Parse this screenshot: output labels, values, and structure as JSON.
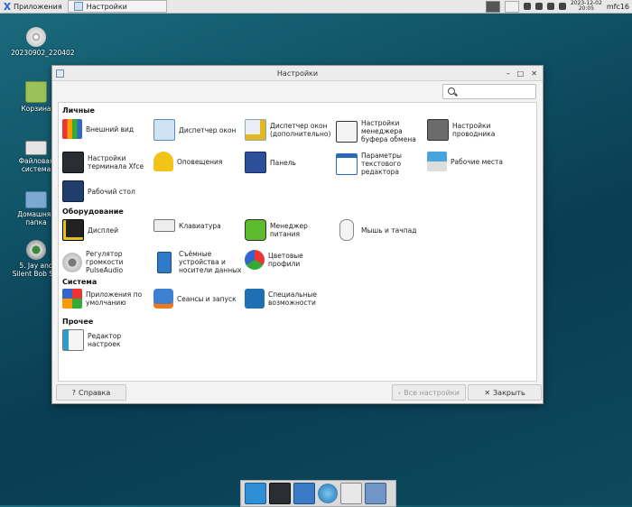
{
  "topbar": {
    "apps_label": "Приложения",
    "task_label": "Настройки",
    "clock_date": "2023-12-02",
    "clock_time": "20:05",
    "user": "mfc16"
  },
  "desktop": [
    {
      "label": "20230902_220402",
      "icon": "disc-icon"
    },
    {
      "label": "Корзина",
      "icon": "trash-icon"
    },
    {
      "label": "Файловая система",
      "icon": "drive-icon"
    },
    {
      "label": "Домашняя папка",
      "icon": "home-folder-icon"
    },
    {
      "label": "5. Jay and Silent Bob S...",
      "icon": "film-icon"
    }
  ],
  "window": {
    "title": "Настройки",
    "search_placeholder": "",
    "sections": {
      "personal": "Личные",
      "hardware": "Оборудование",
      "system": "Система",
      "other": "Прочее"
    },
    "items": {
      "appearance": "Внешний вид",
      "wm": "Диспетчер окон",
      "wm_tweaks": "Диспетчер окон (дополнительно)",
      "clipman": "Настройки менеджера буфера обмена",
      "thunar": "Настройки проводника",
      "terminal": "Настройки терминала Xfce",
      "notify": "Оповещения",
      "panel": "Панель",
      "mousepad": "Параметры текстового редактора",
      "workspaces": "Рабочие места",
      "desktop": "Рабочий стол",
      "display": "Дисплей",
      "keyboard": "Клавиатура",
      "power": "Менеджер питания",
      "mouse": "Мышь и тачпад",
      "pulse": "Регулятор громкости PulseAudio",
      "removable": "Съёмные устройства и носители данных",
      "color": "Цветовые профили",
      "default_apps": "Приложения по умолчанию",
      "sessions": "Сеансы и запуск",
      "a11y": "Специальные возможности",
      "editor": "Редактор настроек"
    },
    "buttons": {
      "help": "Справка",
      "all": "Все настройки",
      "close": "Закрыть"
    }
  },
  "colors": {
    "accent": "#2a64c8",
    "desktop_bg": "#0e4f63"
  }
}
